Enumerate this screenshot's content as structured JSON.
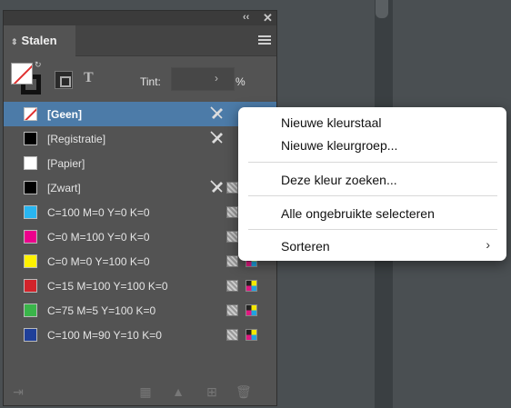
{
  "panel": {
    "collapse_icon": "double-chevron-left",
    "close_icon": "close",
    "tab_label": "Stalen",
    "tint_label": "Tint:",
    "tint_value": "",
    "tint_unit": "%",
    "text_toggle": "T"
  },
  "swatches": [
    {
      "name": "[Geen]",
      "color": "none",
      "selected": true,
      "pencil": true,
      "ico1": true,
      "ico2": false
    },
    {
      "name": "[Registratie]",
      "color": "#000000",
      "selected": false,
      "pencil": true,
      "ico1": false,
      "ico2": false
    },
    {
      "name": "[Papier]",
      "color": "#ffffff",
      "selected": false,
      "pencil": false,
      "ico1": false,
      "ico2": false
    },
    {
      "name": "[Zwart]",
      "color": "#000000",
      "selected": false,
      "pencil": true,
      "ico1": true,
      "ico2": false
    },
    {
      "name": "C=100 M=0 Y=0 K=0",
      "color": "#29b6f1",
      "selected": false,
      "pencil": false,
      "ico1": true,
      "ico2": false
    },
    {
      "name": "C=0 M=100 Y=0 K=0",
      "color": "#ec008c",
      "selected": false,
      "pencil": false,
      "ico1": true,
      "ico2": false
    },
    {
      "name": "C=0 M=0 Y=100 K=0",
      "color": "#fff200",
      "selected": false,
      "pencil": false,
      "ico1": true,
      "ico2": true
    },
    {
      "name": "C=15 M=100 Y=100 K=0",
      "color": "#d2232a",
      "selected": false,
      "pencil": false,
      "ico1": true,
      "ico2": true
    },
    {
      "name": "C=75 M=5 Y=100 K=0",
      "color": "#3ab54a",
      "selected": false,
      "pencil": false,
      "ico1": true,
      "ico2": true
    },
    {
      "name": "C=100 M=90 Y=10 K=0",
      "color": "#1f3f99",
      "selected": false,
      "pencil": false,
      "ico1": true,
      "ico2": true
    }
  ],
  "context_menu": {
    "items": [
      {
        "label": "Nieuwe kleurstaal"
      },
      {
        "label": "Nieuwe kleurgroep..."
      },
      {
        "label": "Deze kleur zoeken..."
      },
      {
        "label": "Alle ongebruikte selecteren"
      },
      {
        "label": "Sorteren",
        "submenu": true
      }
    ]
  }
}
